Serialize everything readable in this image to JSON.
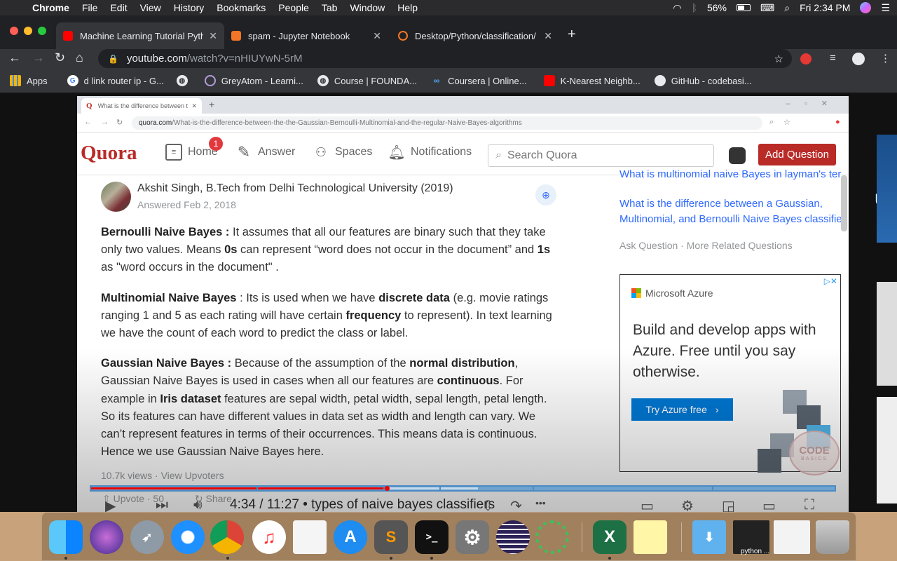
{
  "menubar": {
    "app": "Chrome",
    "items": [
      "File",
      "Edit",
      "View",
      "History",
      "Bookmarks",
      "People",
      "Tab",
      "Window",
      "Help"
    ],
    "battery": "56%",
    "clock": "Fri 2:34 PM"
  },
  "tabs": [
    {
      "title": "Machine Learning Tutorial Pyth",
      "close": "✕"
    },
    {
      "title": "spam - Jupyter Notebook",
      "close": "✕"
    },
    {
      "title": "Desktop/Python/classification/",
      "close": "✕"
    }
  ],
  "newtab": "+",
  "address": {
    "host": "youtube.com",
    "path": "/watch?v=nHIUYwN-5rM"
  },
  "bookmarks": [
    {
      "label": "Apps"
    },
    {
      "label": "d link router ip - G..."
    },
    {
      "label": ""
    },
    {
      "label": "GreyAtom - Learni..."
    },
    {
      "label": "Course | FOUNDA..."
    },
    {
      "label": "Coursera | Online..."
    },
    {
      "label": "K-Nearest Neighb..."
    },
    {
      "label": "GitHub - codebasi..."
    }
  ],
  "inner_browser": {
    "tab_title": "What is the difference between t",
    "url_host": "quora.com",
    "url_path": "/What-is-the-difference-between-the-the-Gaussian-Bernoulli-Multinomial-and-the-regular-Naive-Bayes-algorithms"
  },
  "quora": {
    "logo": "Quora",
    "nav": {
      "home": "Home",
      "home_badge": "1",
      "answer": "Answer",
      "spaces": "Spaces",
      "notifications": "Notifications"
    },
    "search_placeholder": "Search Quora",
    "add_question": "Add Question",
    "author": "Akshit Singh, B.Tech from Delhi Technological University (2019)",
    "answered": "Answered Feb 2, 2018",
    "paragraphs": [
      [
        {
          "t": "Bernoulli Naive Bayes :",
          "b": true
        },
        {
          "t": " It assumes that all our features are binary such that they take only two values. Means ",
          "b": false
        },
        {
          "t": "0s",
          "b": true
        },
        {
          "t": " can represent “word does not occur in the document” and ",
          "b": false
        },
        {
          "t": "1s",
          "b": true
        },
        {
          "t": " as \"word occurs in the document\" .",
          "b": false
        }
      ],
      [
        {
          "t": "Multinomial Naive Bayes",
          "b": true
        },
        {
          "t": " : Its is used when we have ",
          "b": false
        },
        {
          "t": "discrete data",
          "b": true
        },
        {
          "t": " (e.g. movie ratings ranging 1 and 5 as each rating will have certain ",
          "b": false
        },
        {
          "t": "frequency",
          "b": true
        },
        {
          "t": " to represent). In text learning we have the count of each word to predict the class or label.",
          "b": false
        }
      ],
      [
        {
          "t": "Gaussian Naive Bayes :",
          "b": true
        },
        {
          "t": " Because of the assumption of the ",
          "b": false
        },
        {
          "t": "normal distribution",
          "b": true
        },
        {
          "t": ", Gaussian Naive Bayes is used in cases when all our features are ",
          "b": false
        },
        {
          "t": "continuous",
          "b": true
        },
        {
          "t": ". For example in ",
          "b": false
        },
        {
          "t": "Iris dataset",
          "b": true
        },
        {
          "t": " features are sepal width, petal width, sepal length, petal length. So its features can have different values in data set as width and length can vary. We can’t represent features in terms of their occurrences. This means data is continuous. Hence we use Gaussian Naive Bayes here.",
          "b": false
        }
      ]
    ],
    "views": "10.7k views · View Upvoters",
    "upvote": "Upvote · 50",
    "share": "Share",
    "related_cut": "What is multinomial naive Bayes in layman's ter",
    "related_main": "What is the difference between a Gaussian, Multinomial, and Bernoulli Naive Bayes classifie",
    "related_more": "Ask Question · More Related Questions",
    "ad": {
      "brand": "Microsoft Azure",
      "headline": "Build and develop apps with Azure. Free until you say otherwise.",
      "cta": "Try Azure free",
      "ms_colors": [
        "#f25022",
        "#7fba00",
        "#00a4ef",
        "#ffb900"
      ]
    },
    "watermark": {
      "big": "CODE",
      "small": "BASICS"
    }
  },
  "video": {
    "time": "4:34 / 11:27",
    "separator": "•",
    "chapter": "types of naive bayes classifiers",
    "progress": 0.398,
    "buffered": 0.52,
    "chapter_marks": [
      0.222,
      0.393,
      0.468,
      0.594,
      0.835
    ]
  },
  "sidebar_right": {
    "label": "Up"
  },
  "dock": [
    {
      "name": "finder",
      "label": ""
    },
    {
      "name": "siri",
      "label": ""
    },
    {
      "name": "launchpad",
      "label": ""
    },
    {
      "name": "safari",
      "label": ""
    },
    {
      "name": "chrome",
      "label": ""
    },
    {
      "name": "itunes",
      "label": ""
    },
    {
      "name": "preview",
      "label": ""
    },
    {
      "name": "app-store",
      "label": ""
    },
    {
      "name": "sublime",
      "label": "S"
    },
    {
      "name": "terminal",
      "label": ">_"
    },
    {
      "name": "system-preferences",
      "label": ""
    },
    {
      "name": "eclipse",
      "label": ""
    },
    {
      "name": "anaconda",
      "label": ""
    },
    {
      "name": "excel",
      "label": "X"
    },
    {
      "name": "notes",
      "label": ""
    },
    {
      "name": "downloads",
      "label": ""
    },
    {
      "name": "python-window",
      "label": ""
    },
    {
      "name": "excel-window",
      "label": ""
    },
    {
      "name": "trash",
      "label": ""
    }
  ],
  "dock_window_label": "python ..."
}
